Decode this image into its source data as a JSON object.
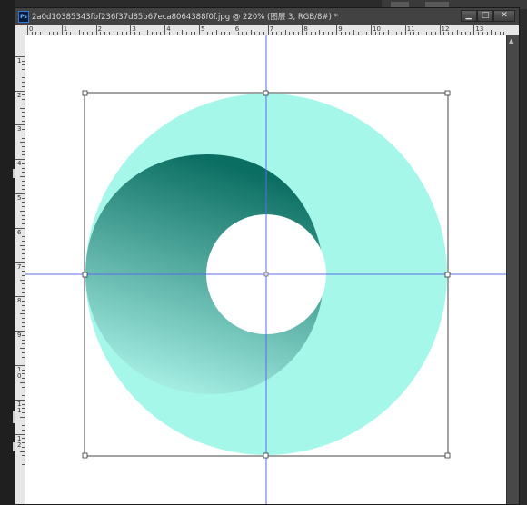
{
  "document": {
    "app_icon": "Ps",
    "title": "2a0d10385343fbf236f37d85b67eca8064388f0f.jpg @ 220% (图层 3, RGB/8#) *",
    "buttons": {
      "minimize": "▁",
      "maximize": "□",
      "close": "✕"
    }
  },
  "rulers": {
    "horizontal_labels": [
      "0",
      "1",
      "2",
      "3",
      "4",
      "5",
      "6",
      "7",
      "8",
      "9",
      "10",
      "11",
      "12",
      "13"
    ],
    "vertical_labels": [
      "1",
      "2",
      "3",
      "4",
      "5",
      "6",
      "7",
      "8",
      "9",
      "10",
      "11",
      "12"
    ]
  },
  "artwork": {
    "ring_color": "#a5f7e9",
    "gradient_dark": "#0b6e62",
    "gradient_light": "#a3ece2",
    "guide_color": "#5b6be8",
    "transform_box": "free-transform"
  },
  "icons": {
    "scroll_up": "scroll-up-arrow-icon"
  }
}
